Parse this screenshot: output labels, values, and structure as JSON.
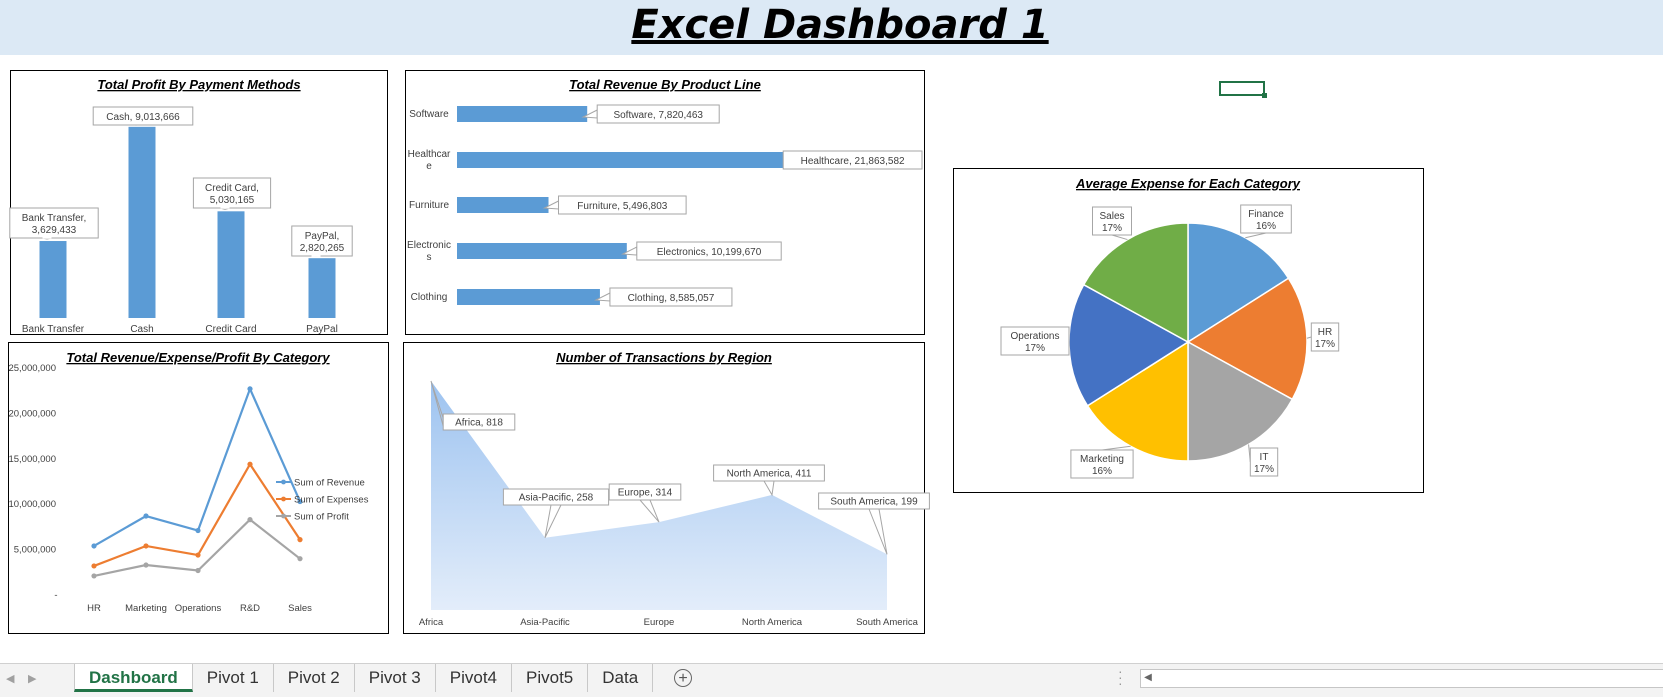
{
  "dashboard": {
    "title": "Excel Dashboard 1"
  },
  "colors": {
    "accent": "#5b9bd5",
    "orange": "#ed7d31",
    "gray": "#a5a5a5",
    "yellow": "#ffc000",
    "blue": "#4472c4",
    "green": "#70ad47",
    "excel_green": "#217346"
  },
  "chart_data": [
    {
      "id": "payment",
      "type": "bar",
      "title": "Total Profit By Payment Methods",
      "categories": [
        "Bank Transfer",
        "Cash",
        "Credit Card",
        "PayPal"
      ],
      "values": [
        3629433,
        9013666,
        5030165,
        2820265
      ],
      "data_labels": [
        [
          "Bank Transfer,",
          "3,629,433"
        ],
        [
          "Cash,  9,013,666"
        ],
        [
          "Credit Card,",
          "5,030,165"
        ],
        [
          "PayPal,",
          "2,820,265"
        ]
      ],
      "ylim": [
        0,
        9100000
      ]
    },
    {
      "id": "product",
      "type": "bar",
      "orientation": "horizontal",
      "title": "Total Revenue By Product Line",
      "categories": [
        "Software",
        "Healthcare",
        "Furniture",
        "Electronics",
        "Clothing"
      ],
      "category_labels": [
        [
          "Software"
        ],
        [
          "Healthcar",
          "e"
        ],
        [
          "Furniture"
        ],
        [
          "Electronic",
          "s"
        ],
        [
          "Clothing"
        ]
      ],
      "values": [
        7820463,
        21863582,
        5496803,
        10199670,
        8585057
      ],
      "data_labels": [
        "Software,  7,820,463",
        "Healthcare,  21,863,582",
        "Furniture,  5,496,803",
        "Electronics,  10,199,670",
        "Clothing,  8,585,057"
      ],
      "xlim": [
        0,
        21863582
      ]
    },
    {
      "id": "category",
      "type": "line",
      "title": "Total Revenue/Expense/Profit By Category",
      "categories": [
        "HR",
        "Marketing",
        "Operations",
        "R&D",
        "Sales"
      ],
      "series": [
        {
          "name": "Sum of Revenue",
          "color": "#5b9bd5",
          "values": [
            5400000,
            8700000,
            7100000,
            22700000,
            10300000
          ]
        },
        {
          "name": "Sum of Expenses",
          "color": "#ed7d31",
          "values": [
            3200000,
            5400000,
            4400000,
            14400000,
            6100000
          ]
        },
        {
          "name": "Sum of Profit",
          "color": "#a5a5a5",
          "values": [
            2100000,
            3300000,
            2700000,
            8300000,
            4000000
          ]
        }
      ],
      "y_ticks": [
        0,
        5000000,
        10000000,
        15000000,
        20000000,
        25000000
      ],
      "y_tick_labels": [
        "-",
        "5,000,000",
        "10,000,000",
        "15,000,000",
        "20,000,000",
        "25,000,000"
      ],
      "ylim": [
        0,
        25000000
      ],
      "legend": "right"
    },
    {
      "id": "region",
      "type": "area",
      "title": "Number of Transactions by Region",
      "categories": [
        "Africa",
        "Asia-Pacific",
        "Europe",
        "North America",
        "South America"
      ],
      "values": [
        818,
        258,
        314,
        411,
        199
      ],
      "data_labels": [
        "Africa, 818",
        "Asia-Pacific, 258",
        "Europe, 314",
        "North America, 411",
        "South America, 199"
      ],
      "ylim": [
        0,
        850
      ]
    },
    {
      "id": "expense",
      "type": "pie",
      "title": "Average Expense for Each Category",
      "labels": [
        "Finance",
        "HR",
        "IT",
        "Marketing",
        "Operations",
        "Sales"
      ],
      "percent_labels": [
        "16%",
        "17%",
        "17%",
        "16%",
        "17%",
        "17%"
      ],
      "values": [
        16,
        17,
        17,
        16,
        17,
        17
      ],
      "colors": [
        "#5b9bd5",
        "#ed7d31",
        "#a5a5a5",
        "#ffc000",
        "#4472c4",
        "#70ad47"
      ]
    }
  ],
  "sheet_tabs": [
    {
      "label": "Dashboard",
      "active": true
    },
    {
      "label": "Pivot 1"
    },
    {
      "label": "Pivot 2"
    },
    {
      "label": "Pivot 3"
    },
    {
      "label": "Pivot4"
    },
    {
      "label": "Pivot5"
    },
    {
      "label": "Data"
    }
  ],
  "icons": {
    "add_sheet": "plus-circle-icon",
    "scroll_left": "chevron-left-icon"
  }
}
